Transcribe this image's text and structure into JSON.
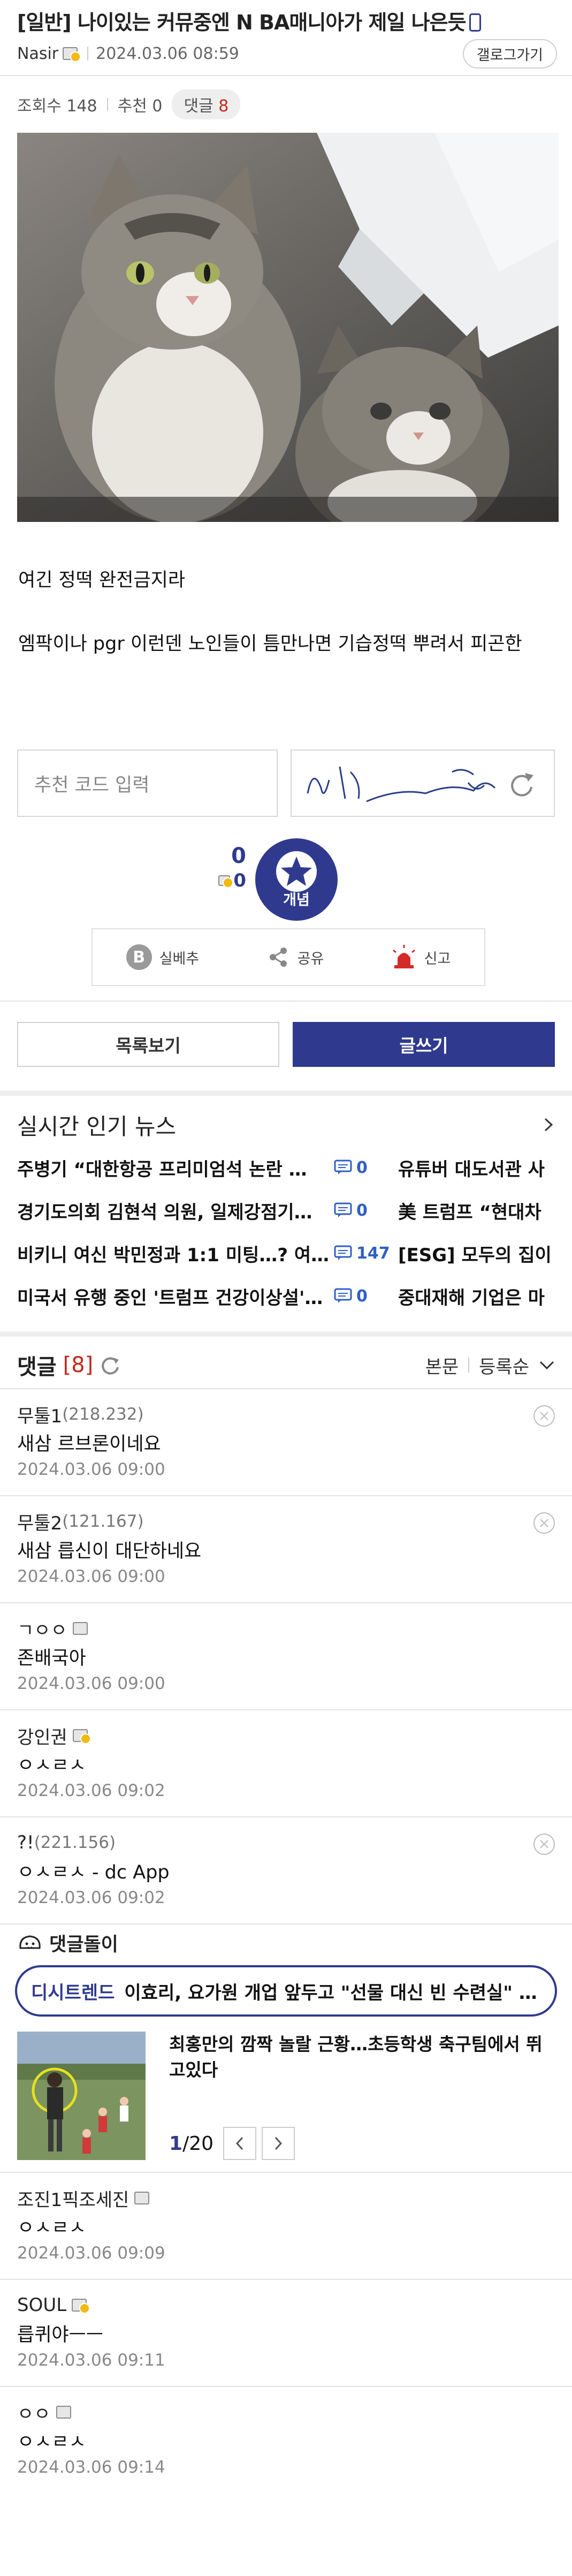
{
  "post": {
    "title": "[일반] 나이있는 커뮤중엔 N BA매니아가 제일 나은듯",
    "author": "Nasir",
    "date": "2024.03.06 08:59",
    "gallery_button": "갤로그가기",
    "views_label": "조회수 148",
    "recommend_label": "추천 0",
    "comments_label": "댓글",
    "comments_count": "8",
    "body": [
      "여긴 정떡 완전금지라",
      "엠팍이나 pgr 이런덴 노인들이 틈만나면 기습정떡 뿌려서 피곤한"
    ]
  },
  "recommend": {
    "code_placeholder": "추천 코드 입력",
    "count": "0",
    "fixed_count": "0",
    "button_label": "개념",
    "actions": [
      "실베추",
      "공유",
      "신고"
    ]
  },
  "buttons": {
    "list": "목록보기",
    "write": "글쓰기"
  },
  "news": {
    "title": "실시간 인기 뉴스",
    "rows": [
      {
        "left": "주병기 “대한항공 프리미엄석 논란 …",
        "count": "0",
        "right": "유튜버 대도서관 사"
      },
      {
        "left": "경기도의회 김현석 의원, 일제강점기…",
        "count": "0",
        "right": "美 트럼프 “현대차"
      },
      {
        "left": "비키니 여신 박민정과 1:1 미팅…? 여…",
        "count": "147",
        "right": "[ESG] 모두의 집이"
      },
      {
        "left": "미국서 유행 중인 '트럼프 건강이상설'…",
        "count": "0",
        "right": "중대재해 기업은 마"
      }
    ]
  },
  "comments_section": {
    "title": "댓글",
    "count": "[8]",
    "sort_body": "본문",
    "sort_order": "등록순",
    "items": [
      {
        "nick": "무툴1",
        "ip": "(218.232)",
        "text": "새삼 르브론이네요",
        "date": "2024.03.06 09:00",
        "deletable": true
      },
      {
        "nick": "무툴2",
        "ip": "(121.167)",
        "text": "새삼 릅신이 대단하네요",
        "date": "2024.03.06 09:00",
        "deletable": true
      },
      {
        "nick": "ㄱㅇㅇ",
        "ip": "",
        "text": "존배국아",
        "date": "2024.03.06 09:00",
        "deletable": false
      },
      {
        "nick": "강인권",
        "ip": "",
        "text": "ㅇㅅㄹㅅ",
        "date": "2024.03.06 09:02",
        "deletable": false
      },
      {
        "nick": "?!",
        "ip": "(221.156)",
        "text": "ㅇㅅㄹㅅ - dc App",
        "date": "2024.03.06 09:02",
        "deletable": true
      }
    ]
  },
  "bot": {
    "title": "댓글돌이",
    "trend_tag": "디시트렌드",
    "trend_text": "이효리, 요가원 개업 앞두고 \"선물 대신 빈 수련실\" …",
    "ad_headline": "최홍만의 깜짝 놀랄 근황…초등학생 축구팀에서 뛰고있다",
    "pager_current": "1",
    "pager_total": "/20"
  },
  "comments_more": [
    {
      "nick": "조진1픽조세진",
      "text": "ㅇㅅㄹㅅ",
      "date": "2024.03.06 09:09"
    },
    {
      "nick": "SOUL",
      "text": "릅퀴야ㅡㅡ",
      "date": "2024.03.06 09:11"
    },
    {
      "nick": "ㅇㅇ",
      "text": "ㅇㅅㄹㅅ",
      "date": "2024.03.06 09:14"
    }
  ]
}
